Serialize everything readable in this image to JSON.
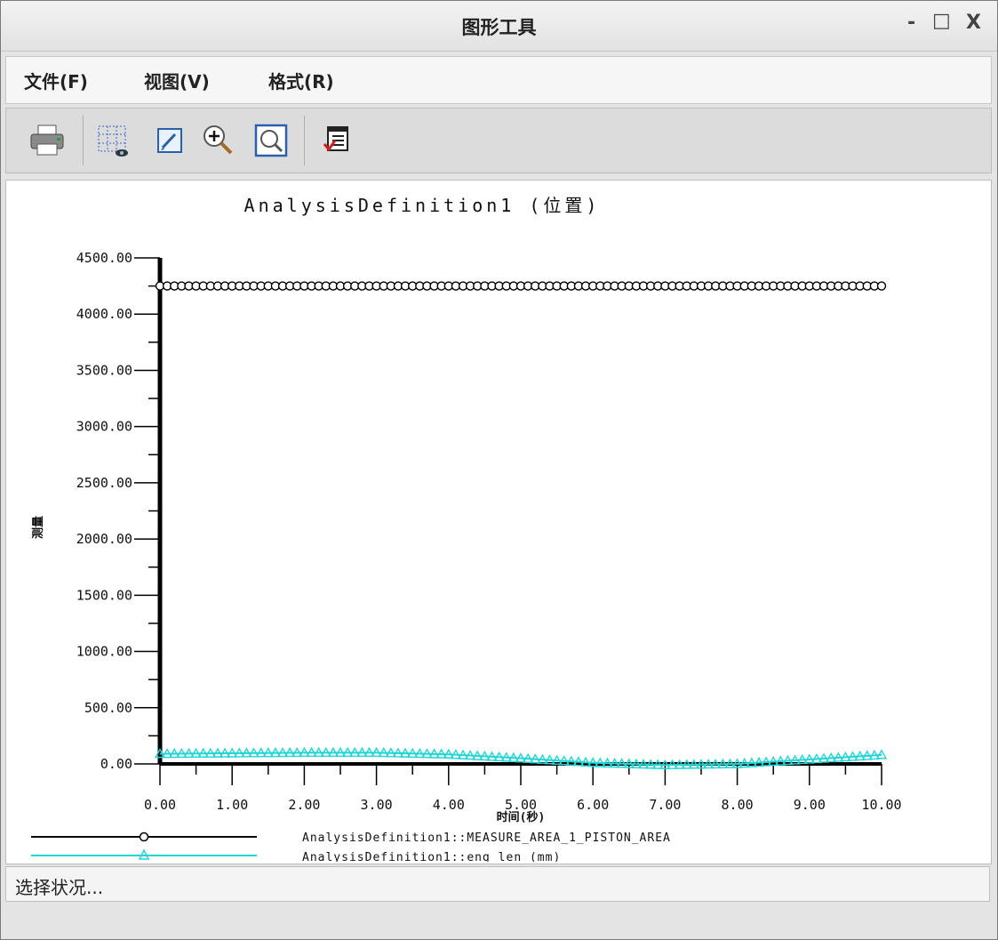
{
  "window": {
    "title": "图形工具",
    "controls": {
      "minimize": "-",
      "maximize": "□",
      "close": "X"
    }
  },
  "menu": {
    "items": [
      "文件(F)",
      "视图(V)",
      "格式(R)"
    ]
  },
  "toolbar": {
    "buttons": [
      "print-icon",
      "grid-view-icon",
      "edit-icon",
      "zoom-in-icon",
      "zoom-fit-icon",
      "export-report-icon"
    ]
  },
  "status": {
    "text": "选择状况..."
  },
  "colors": {
    "series1": "#000000",
    "series2": "#22d6d6"
  },
  "chart_data": {
    "type": "line",
    "title": "AnalysisDefinition1 (位置)",
    "xlabel": "时间(秒)",
    "ylabel": "测量",
    "xlim": [
      0,
      10
    ],
    "ylim": [
      0,
      4500
    ],
    "xticks": [
      "0.00",
      "1.00",
      "2.00",
      "3.00",
      "4.00",
      "5.00",
      "6.00",
      "7.00",
      "8.00",
      "9.00",
      "10.00"
    ],
    "yticks": [
      "0.00",
      "500.00",
      "1000.00",
      "1500.00",
      "2000.00",
      "2500.00",
      "3000.00",
      "3500.00",
      "4000.00",
      "4500.00"
    ],
    "series": [
      {
        "name": "AnalysisDefinition1::MEASURE_AREA_1_PISTON_AREA",
        "marker": "circle",
        "x": [
          0,
          1,
          2,
          3,
          4,
          5,
          6,
          7,
          8,
          9,
          10
        ],
        "values": [
          4250,
          4250,
          4250,
          4250,
          4250,
          4250,
          4250,
          4250,
          4250,
          4250,
          4250
        ]
      },
      {
        "name": "AnalysisDefinition1::eng_len (mm)",
        "marker": "triangle",
        "x": [
          0,
          1,
          2,
          3,
          4,
          5,
          6,
          7,
          8,
          9,
          10
        ],
        "values": [
          90,
          95,
          100,
          100,
          85,
          50,
          10,
          -10,
          0,
          40,
          80
        ]
      }
    ],
    "legend_position": "bottom-left",
    "grid": false
  }
}
